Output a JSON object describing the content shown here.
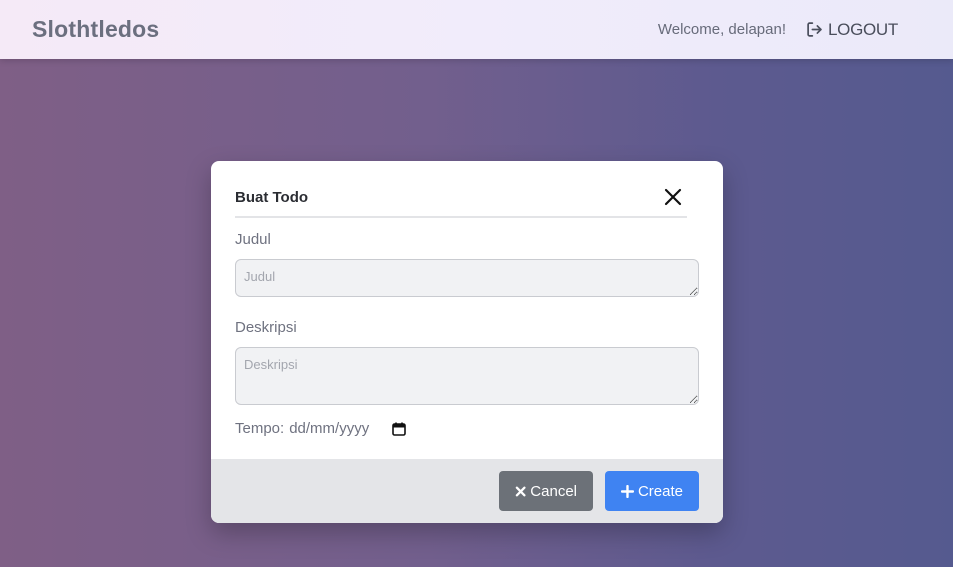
{
  "navbar": {
    "brand": "Slothtledos",
    "welcome": "Welcome, delapan!",
    "logout_label": "LOGOUT"
  },
  "modal": {
    "title": "Buat Todo",
    "fields": {
      "judul_label": "Judul",
      "judul_placeholder": "Judul",
      "deskripsi_label": "Deskripsi",
      "deskripsi_placeholder": "Deskripsi",
      "tempo_label": "Tempo:",
      "tempo_value": "dd/mm/yyyy"
    },
    "buttons": {
      "cancel_label": "Cancel",
      "create_label": "Create"
    }
  },
  "colors": {
    "cancel": "#6c7178",
    "create": "#3f83f2"
  }
}
